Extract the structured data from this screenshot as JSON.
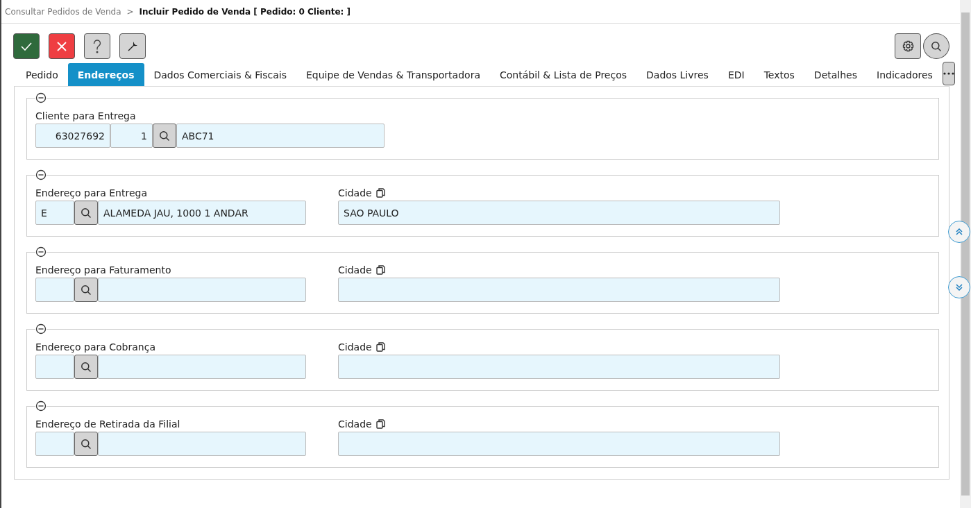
{
  "breadcrumb": {
    "parent": "Consultar Pedidos de Venda",
    "separator": ">",
    "current": "Incluir Pedido de Venda [ Pedido: 0 Cliente: ]"
  },
  "tabs": [
    {
      "label": "Pedido",
      "selected": false
    },
    {
      "label": "Endereços",
      "selected": true
    },
    {
      "label": "Dados Comerciais & Fiscais",
      "selected": false
    },
    {
      "label": "Equipe de Vendas & Transportadora",
      "selected": false
    },
    {
      "label": "Contábil & Lista de Preços",
      "selected": false
    },
    {
      "label": "Dados Livres",
      "selected": false
    },
    {
      "label": "EDI",
      "selected": false
    },
    {
      "label": "Textos",
      "selected": false
    },
    {
      "label": "Detalhes",
      "selected": false
    },
    {
      "label": "Indicadores",
      "selected": false
    }
  ],
  "sections": [
    {
      "kind": "client",
      "label": "Cliente para Entrega",
      "code": "63027692",
      "seq": "1",
      "name": "ABC71"
    },
    {
      "kind": "address",
      "label": "Endereço para Entrega",
      "code": "E",
      "description": "ALAMEDA JAU, 1000 1 ANDAR",
      "city_label": "Cidade",
      "city": "SAO PAULO"
    },
    {
      "kind": "address",
      "label": "Endereço para Faturamento",
      "city_label": "Cidade"
    },
    {
      "kind": "address",
      "label": "Endereço para Cobrança",
      "city_label": "Cidade"
    },
    {
      "kind": "address",
      "label": "Endereço de Retirada da Filial",
      "city_label": "Cidade"
    }
  ]
}
